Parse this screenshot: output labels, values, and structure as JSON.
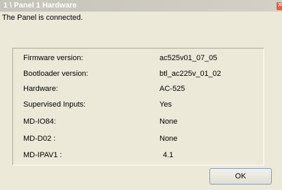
{
  "window": {
    "title": "1 \\ Panel 1 Hardware",
    "status_text": "The Panel is connected."
  },
  "info": {
    "rows": [
      {
        "label": "Firmware version:",
        "value": "ac525v01_07_05"
      },
      {
        "label": "Bootloader version:",
        "value": "btl_ac225v_01_02"
      },
      {
        "label": "Hardware:",
        "value": "AC-525"
      },
      {
        "label": "Supervised Inputs:",
        "value": "Yes"
      },
      {
        "label": "MD-IO84:",
        "value": "None"
      },
      {
        "label": "MD-D02 :",
        "value": "None"
      },
      {
        "label": "MD-IPAV1 :",
        "value": "4.1"
      }
    ]
  },
  "buttons": {
    "ok_label": "OK"
  },
  "icons": {
    "close": "close-icon"
  },
  "colors": {
    "window_bg": "#ece9d8",
    "close_button": "#e0633c"
  }
}
